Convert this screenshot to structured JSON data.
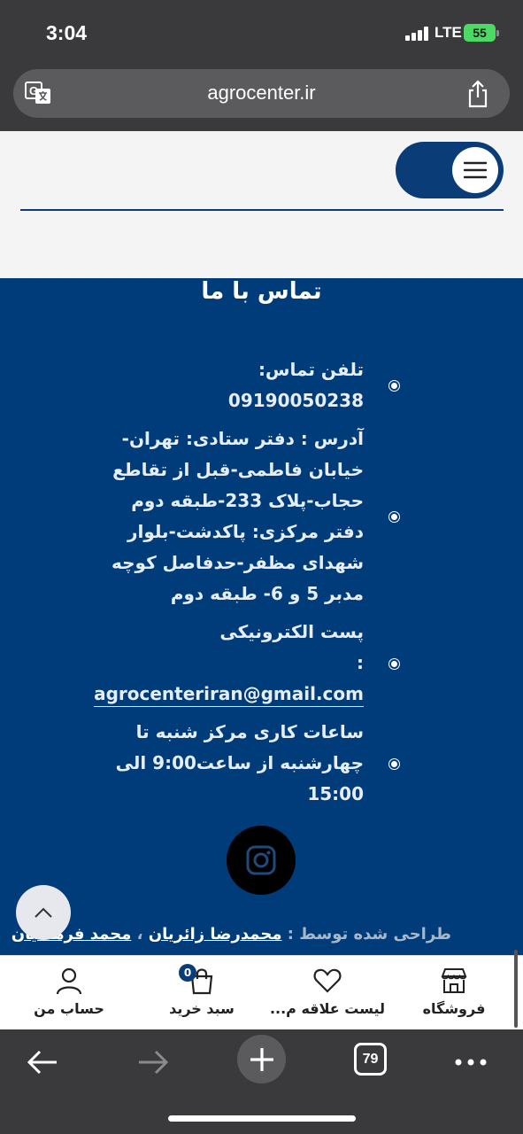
{
  "status": {
    "time": "3:04",
    "network": "LTE",
    "battery": "55"
  },
  "browser": {
    "url": "agrocenter.ir",
    "tab_count": "79"
  },
  "icons": {
    "translate": "translate-icon",
    "share": "share-icon",
    "menu": "hamburger-icon",
    "instagram": "instagram-icon",
    "scroll_top": "chevron-up-icon",
    "back": "arrow-left-icon",
    "forward": "arrow-right-icon",
    "new_tab": "plus-icon",
    "more": "ellipsis-icon"
  },
  "colors": {
    "brand": "#003c7a",
    "header_toggle": "#0a3d78",
    "page_bg": "#f4f4f4",
    "browser_chrome": "#3a3a3c",
    "battery": "#4cd964"
  },
  "footer": {
    "title": "تماس با ما",
    "items": [
      {
        "lines": [
          "تلفن تماس:",
          "09190050238"
        ]
      },
      {
        "lines": [
          "آدرس : دفتر ستادی: تهران-",
          "خیابان فاطمی-قبل از تقاطع",
          "حجاب-پلاک 233-طبقه دوم",
          "دفتر مرکزی: پاکدشت-بلوار",
          "شهدای مظفر-حدفاصل کوچه",
          "مدبر 5 و 6- طبقه دوم"
        ]
      },
      {
        "label": "پست الکترونیکی",
        "email": "agrocenteriran@gmail.com",
        "suffix": " :"
      },
      {
        "lines": [
          "ساعات کاری مرکز شنبه تا",
          "چهارشنبه از ساعت9:00 الی",
          "15:00"
        ]
      }
    ],
    "credit_prefix": "طراحی شده توسط :",
    "credit_name_1": "محمدرضا زائریان",
    "credit_sep": " ، ",
    "credit_name_2": "محمد فرهنگیان"
  },
  "site_nav": {
    "shop": "فروشگاه",
    "wishlist": "لیست علاقه م...",
    "cart": "سبد خرید",
    "cart_count": "0",
    "account": "حساب من"
  }
}
